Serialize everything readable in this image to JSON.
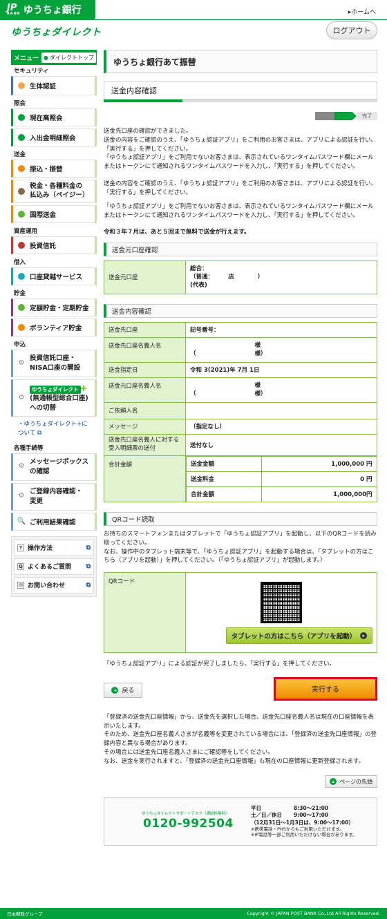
{
  "header": {
    "bank_logo_text": "JP",
    "bank_logo_sub": "BANK",
    "bank_name": "ゆうちょ銀行",
    "home_link": "▸ホームへ",
    "brand": "ゆうちょダイレクト",
    "logout": "ログアウト"
  },
  "sidebar": {
    "menu_label": "メニュー",
    "direct_top": "ダイレクトトップ",
    "sections": {
      "security": "セキュリティ",
      "inquiry": "照会",
      "transfer": "送金",
      "asset": "資産運用",
      "borrow": "借入",
      "savings": "貯金",
      "apply": "申込",
      "procedures": "各種手続等"
    },
    "items": {
      "biometric": "生体認証",
      "balance": "現在高照会",
      "history": "入出金明細照会",
      "transfer": "振込・振替",
      "payeasy_line1": "税金・各種料金の",
      "payeasy_line2": "払込み（ペイジー）",
      "intl": "国際送金",
      "investment": "投資信託",
      "loan": "口座貸越サービス",
      "fixed": "定額貯金・定期貯金",
      "volunteer": "ボランティア貯金",
      "nisa_line1": "投資信託口座・",
      "nisa_line2": "NISA口座の開設",
      "plus_badge": "ゆうちょダイレクト",
      "switch_line1": "(無通帳型総合口座)",
      "switch_line2": "への切替",
      "plus_about": "ゆうちょダイレクト+について",
      "messagebox_line1": "メッセージボックス",
      "messagebox_line2": "の確認",
      "registration_line1": "ご登録内容確認・",
      "registration_line2": "変更",
      "usage": "ご利用結果確認"
    },
    "sub_links": [
      "操作方法",
      "よくあるご質問",
      "お問い合わせ"
    ]
  },
  "main": {
    "page_title": "ゆうちょ銀行あて振替",
    "step_title": "送金内容確認",
    "progress_done": "完了",
    "paragraphs": [
      "送金先口座の確認ができました。\n送金の内容をご確認のうえ、「ゆうちょ認証アプリ」をご利用のお客さまは、アプリによる認証を行い、「実行する」を押してください。\n「ゆうちょ認証アプリ」をご利用でないお客さまは、表示されているワンタイムパスワード欄にメールまたはトークンにて通知されるワンタイムパスワードを入力し、「実行する」を押してください。",
      "送金の内容をご確認のうえ、「ゆうちょ認証アプリ」をご利用のお客さまは、アプリによる認証を行い、「実行する」を押してください。",
      "「ゆうちょ認証アプリ」をご利用でないお客さまは、表示されているワンタイムパスワード欄にメールまたはトークンにて通知されるワンタイムパスワードを入力し、「実行する」を押してください。"
    ],
    "limit_note": "令和３年７月は、あと５回まで無料で送金が行えます。",
    "source": {
      "heading": "送金元口座確認",
      "label": "送金元口座",
      "value_line1": "総合：",
      "value_line2": "（普通：　　　店　　　　）",
      "value_line3": "(代表)"
    },
    "content": {
      "heading": "送金内容確認",
      "rows": [
        {
          "label": "送金先口座",
          "value_line1": "記号番号：",
          "value_line2": ""
        },
        {
          "label": "送金先口座名義人名",
          "value_line1": "　　　　　　　　　　　様",
          "value_line2": "（　　　　　　　　　　様）"
        },
        {
          "label": "送金指定日",
          "value_line1": "令和 3(2021)年 7月 1日",
          "value_line2": ""
        },
        {
          "label": "送金元口座名義人名",
          "value_line1": "　　　　　　　　　　　様",
          "value_line2": "（　　　　　　　　　　様）"
        },
        {
          "label": "ご依頼人名",
          "value_line1": "",
          "value_line2": ""
        },
        {
          "label": "メッセージ",
          "value_line1": "（指定なし）",
          "value_line2": ""
        },
        {
          "label": "送金先口座名義人に対する受入明細票の送付",
          "value_line1": "送付なし",
          "value_line2": ""
        }
      ],
      "total_label": "合計金額",
      "amounts": [
        {
          "label": "送金金額",
          "value": "1,000,000 円"
        },
        {
          "label": "送金料金",
          "value": "0 円"
        },
        {
          "label": "合計金額",
          "value": "1,000,000円"
        }
      ]
    },
    "qr": {
      "heading": "QRコード読取",
      "text1": "お持ちのスマートフォンまたはタブレットで「ゆうちょ認証アプリ」を起動し、以下のQRコードを読み取ってください。",
      "text2": "なお、操作中のタブレット端末等で、「ゆうちょ認証アプリ」を起動する場合は、「タブレットの方はこちら（アプリを起動）」を押してください。（「ゆうちょ認証アプリ」が起動します。）",
      "label": "QRコード",
      "tablet_button": "タブレットの方はこちら（アプリを起動）"
    },
    "after_auth": "「ゆうちょ認証アプリ」による認証が完了しましたら、「実行する」を押してください。",
    "back": "戻る",
    "execute": "実行する",
    "notes": "「登録済の送金先口座情報」から、送金先を選択した場合、送金先口座名義人名は現在の口座情報を表示いたします。\nそのため、送金先口座名義人さまが名義等を変更されている場合には、「登録済の送金先口座情報」の登録内容と異なる場合があります。\nその場合には送金先口座名義人さまにご確認等をしてください。\nなお、送金を実行されますと、「登録済の送金先口座情報」も現在の口座情報に更新登録されます。",
    "page_top": "ページの先頭"
  },
  "support": {
    "desk": "ゆうちょダイレクトサポートデスク（通話料無料）",
    "tel": "0120-992504",
    "weekday_label": "平日",
    "weekday_hours": "8:30～21:00",
    "weekend_label": "土／日／休日",
    "weekend_hours": "9:00～17:00",
    "newyear": "（12月31日～1月3日は、9:00～17:00）",
    "note1": "※携帯電話・PHSからもご利用いただけます。",
    "note2": "※IP電話等一部ご利用いただけない場合があります。"
  },
  "footer": {
    "group": "日本郵政グループ",
    "copyright": "Copyright © JAPAN POST BANK Co.,Ltd All Rights Reserved."
  },
  "colors": {
    "brand_green": "#00a23a",
    "table_border": "#7cc04a",
    "label_bg": "#e1f2cf",
    "execute_orange": "#ef8b00",
    "execute_border": "#e3001b"
  }
}
